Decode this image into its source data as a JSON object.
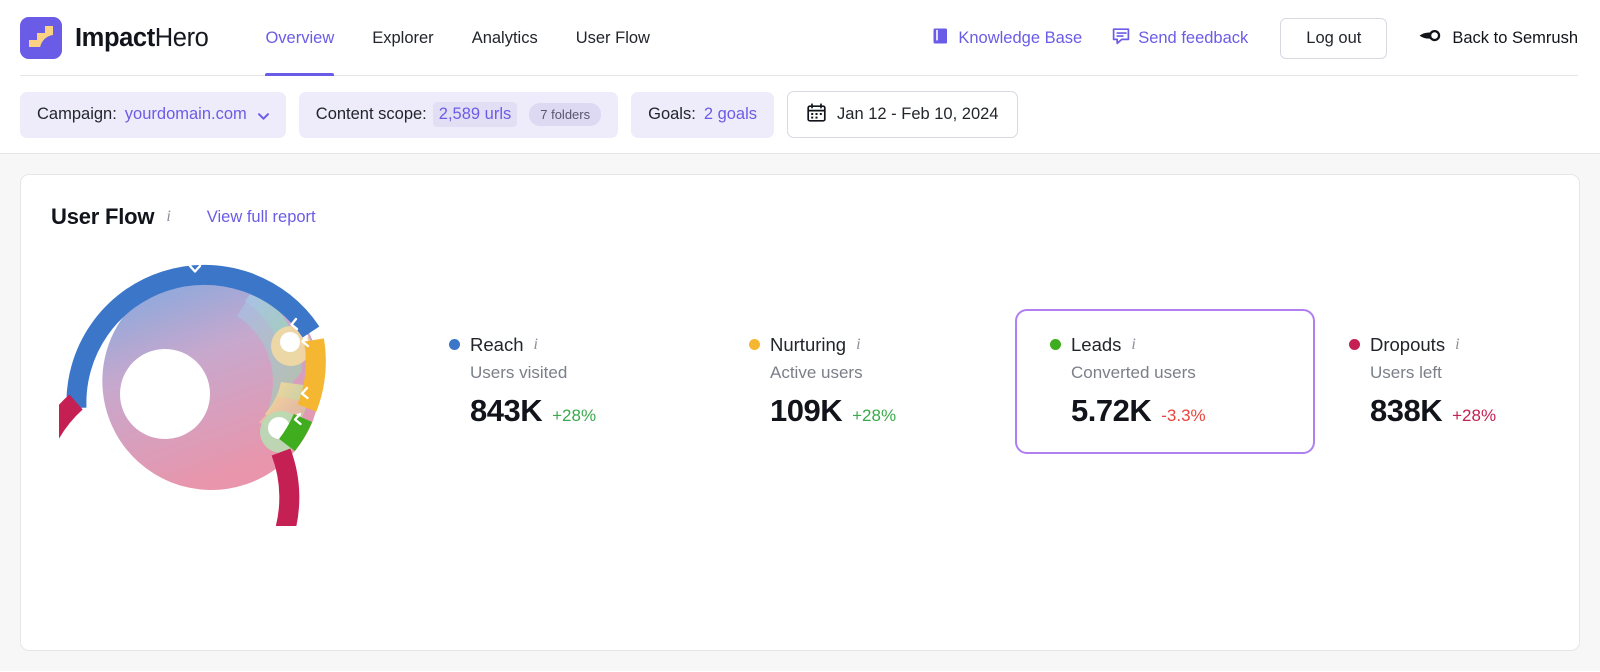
{
  "brand": {
    "name_strong": "Impact",
    "name_light": "Hero",
    "logo_icon": "impact-hero-logo",
    "logo_bg": "#6b5ce7",
    "logo_fg": "#fbd283"
  },
  "nav": {
    "items": [
      {
        "label": "Overview",
        "active": true
      },
      {
        "label": "Explorer",
        "active": false
      },
      {
        "label": "Analytics",
        "active": false
      },
      {
        "label": "User Flow",
        "active": false
      }
    ],
    "accent": "#6b5ce7"
  },
  "header_right": {
    "knowledge_base": {
      "label": "Knowledge Base",
      "icon": "book-icon"
    },
    "send_feedback": {
      "label": "Send feedback",
      "icon": "speech-bubble-icon"
    },
    "logout": {
      "label": "Log out"
    },
    "back_to_semrush": {
      "label": "Back to Semrush",
      "icon": "semrush-comet-icon"
    }
  },
  "filters": {
    "campaign": {
      "label": "Campaign:",
      "value": "yourdomain.com",
      "chevron_icon": "chevron-down-icon"
    },
    "content_scope": {
      "label": "Content scope:",
      "value": "2,589 urls",
      "badge": "7 folders"
    },
    "goals": {
      "label": "Goals:",
      "value": "2 goals"
    },
    "date_range": {
      "value": "Jan 12 - Feb 10, 2024",
      "icon": "calendar-icon"
    }
  },
  "user_flow_card": {
    "title": "User Flow",
    "info_icon": "info-icon",
    "report_link": "View full report",
    "metrics": [
      {
        "name": "Reach",
        "subtitle": "Users visited",
        "value": "843K",
        "delta": "+28%",
        "delta_dir": "up",
        "color": "#3b76c9",
        "highlighted": false,
        "info_icon": "info-icon"
      },
      {
        "name": "Nurturing",
        "subtitle": "Active users",
        "value": "109K",
        "delta": "+28%",
        "delta_dir": "up",
        "color": "#f5b731",
        "highlighted": false,
        "info_icon": "info-icon"
      },
      {
        "name": "Leads",
        "subtitle": "Converted users",
        "value": "5.72K",
        "delta": "-3.3%",
        "delta_dir": "down",
        "color": "#3fad1e",
        "highlighted": true,
        "info_icon": "info-icon"
      },
      {
        "name": "Dropouts",
        "subtitle": "Users left",
        "value": "838K",
        "delta": "+28%",
        "delta_dir": "neg",
        "color": "#c42053",
        "highlighted": false,
        "info_icon": "info-icon"
      }
    ],
    "highlight_border_color": "#b07ff0"
  },
  "chart_data": {
    "type": "pie",
    "title": "User Flow",
    "subtype": "chord-donut",
    "legend_position": "right",
    "categories": [
      "Reach",
      "Nurturing",
      "Leads",
      "Dropouts"
    ],
    "values": [
      843000,
      109000,
      5720,
      838000
    ],
    "display_values": [
      "843K",
      "109K",
      "5.72K",
      "838K"
    ],
    "colors": [
      "#3b76c9",
      "#f5b731",
      "#3fad1e",
      "#c42053"
    ],
    "deltas": [
      "+28%",
      "+28%",
      "-3.3%",
      "+28%"
    ],
    "ring_segments": [
      {
        "name": "Reach",
        "color": "#3b76c9",
        "start_deg": 255,
        "end_deg": 20,
        "share": 0.35
      },
      {
        "name": "Nurturing",
        "color": "#f5b731",
        "start_deg": 20,
        "end_deg": 57,
        "share": 0.1
      },
      {
        "name": "Leads",
        "color": "#3fad1e",
        "start_deg": 57,
        "end_deg": 75,
        "share": 0.05
      },
      {
        "name": "Dropouts",
        "color": "#c42053",
        "start_deg": 75,
        "end_deg": 255,
        "share": 0.5
      }
    ]
  }
}
